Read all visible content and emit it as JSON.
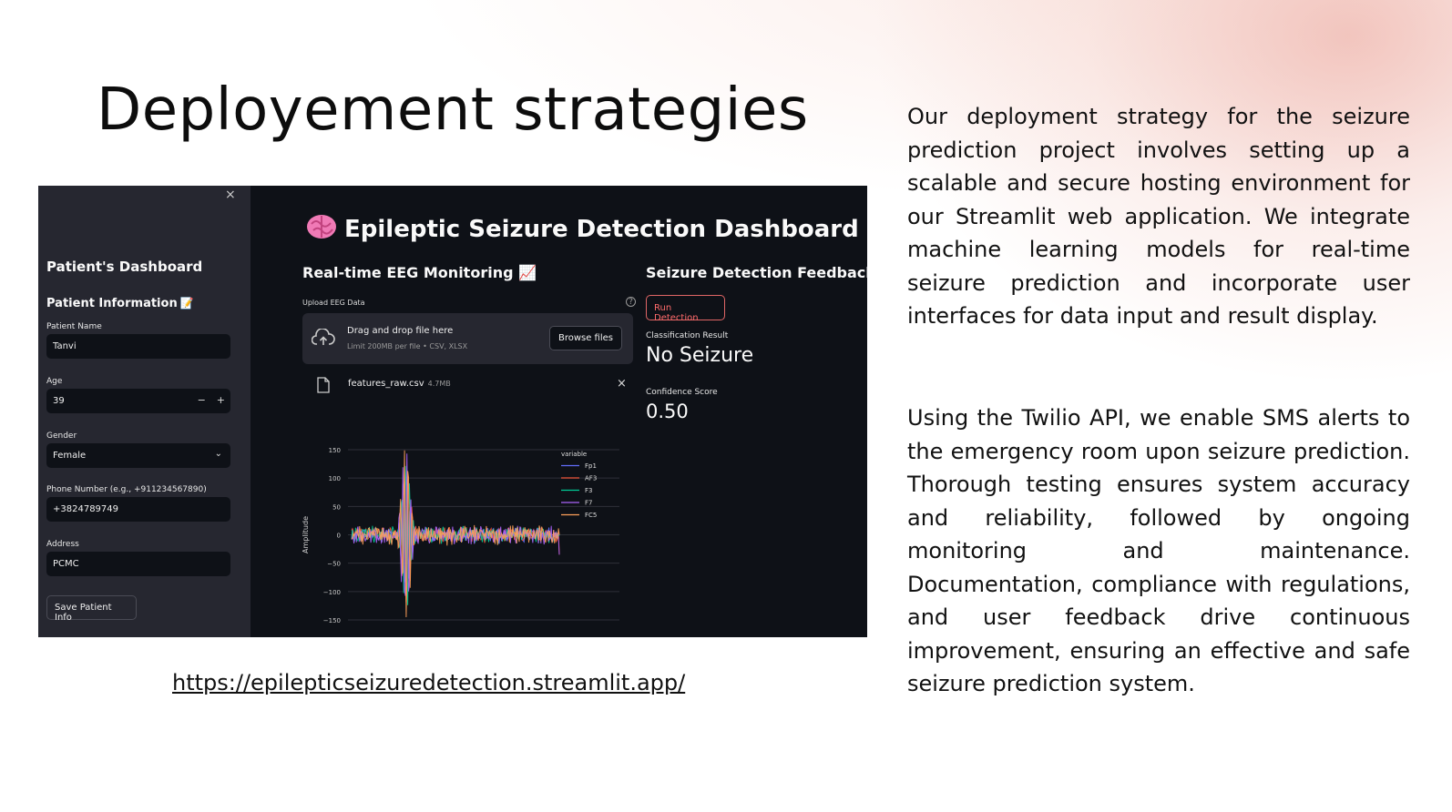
{
  "slide": {
    "title": "Deployement strategies",
    "paragraph_1": "Our deployment strategy for the seizure prediction project involves setting up a scalable and secure hosting environment for our Streamlit web application. We integrate machine learning models for real-time seizure prediction and incorporate user interfaces for data input and result display.",
    "paragraph_2": "Using the Twilio API, we enable SMS alerts to the emergency room upon seizure prediction. Thorough testing ensures system accuracy and reliability, followed by ongoing monitoring and maintenance. Documentation, compliance with regulations, and user feedback drive continuous improvement, ensuring an effective and safe seizure prediction system.",
    "link": "https://epilepticseizuredetection.streamlit.app/"
  },
  "app": {
    "sidebar": {
      "close_glyph": "×",
      "title": "Patient's Dashboard",
      "section": "Patient Information",
      "section_glyph": "📝",
      "name_label": "Patient Name",
      "name_value": "Tanvi",
      "age_label": "Age",
      "age_value": "39",
      "minus": "−",
      "plus": "+",
      "gender_label": "Gender",
      "gender_value": "Female",
      "chevron": "⌄",
      "phone_label": "Phone Number (e.g., +911234567890)",
      "phone_value": "+3824789749",
      "address_label": "Address",
      "address_value": "PCMC",
      "save_button": "Save Patient Info"
    },
    "main": {
      "title": "Epileptic Seizure Detection Dashboard",
      "monitor_heading": "Real-time EEG Monitoring 📈",
      "upload_label": "Upload EEG Data",
      "help_glyph": "?",
      "drop_main": "Drag and drop file here",
      "drop_sub": "Limit 200MB per file • CSV, XLSX",
      "browse_button": "Browse files",
      "file_name": "features_raw.csv",
      "file_size": "4.7MB",
      "file_remove": "×",
      "feedback_heading": "Seizure Detection Feedback",
      "run_button": "Run Detection",
      "class_label": "Classification Result",
      "class_value": "No Seizure",
      "conf_label": "Confidence Score",
      "conf_value": "0.50"
    }
  },
  "chart_data": {
    "type": "line",
    "ylabel": "Amplitude",
    "ylim": [
      -150,
      150
    ],
    "yticks": [
      "150",
      "100",
      "50",
      "0",
      "−50",
      "−100",
      "−150"
    ],
    "legend_title": "variable",
    "legend_position": "top-right",
    "series": [
      {
        "name": "Fp1",
        "color": "#636efa"
      },
      {
        "name": "AF3",
        "color": "#ef553b"
      },
      {
        "name": "F3",
        "color": "#00cc96"
      },
      {
        "name": "F7",
        "color": "#ab63fa"
      },
      {
        "name": "FC5",
        "color": "#ffa15a"
      }
    ]
  }
}
